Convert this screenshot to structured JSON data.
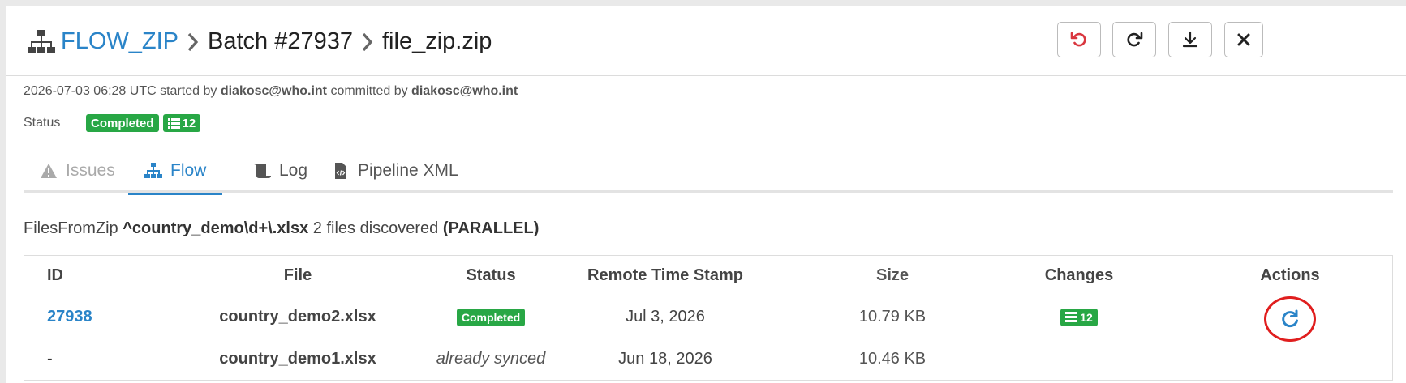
{
  "breadcrumb": {
    "root": "FLOW_ZIP",
    "batch": "Batch #27937",
    "file": "file_zip.zip"
  },
  "header_buttons": [
    {
      "name": "undo",
      "icon": "undo-icon",
      "color": "#d9363e"
    },
    {
      "name": "redo",
      "icon": "redo-icon",
      "color": "#222222"
    },
    {
      "name": "download",
      "icon": "download-icon",
      "color": "#222222"
    },
    {
      "name": "close",
      "icon": "close-icon",
      "color": "#222222"
    }
  ],
  "meta": {
    "timestamp": "2026-07-03 06:28 UTC",
    "started_by_label": "started by",
    "started_by": "diakosc@who.int",
    "committed_by_label": "committed by",
    "committed_by": "diakosc@who.int"
  },
  "status": {
    "label": "Status",
    "value": "Completed",
    "changes_count": "12"
  },
  "tabs": [
    {
      "label": "Issues",
      "icon": "warning-icon",
      "state": "disabled"
    },
    {
      "label": "Flow",
      "icon": "sitemap-icon",
      "state": "active"
    },
    {
      "label": "Log",
      "icon": "scroll-icon",
      "state": "normal"
    },
    {
      "label": "Pipeline XML",
      "icon": "code-file-icon",
      "state": "normal"
    }
  ],
  "files_line": {
    "prefix": "FilesFromZip",
    "pattern": "^country_demo\\d+\\.xlsx",
    "count_text": "2 files discovered",
    "mode": "(PARALLEL)"
  },
  "table": {
    "headers": [
      "ID",
      "File",
      "Status",
      "Remote Time Stamp",
      "Size",
      "Changes",
      "Actions"
    ],
    "rows": [
      {
        "id": "27938",
        "file": "country_demo2.xlsx",
        "status": "Completed",
        "timestamp": "Jul 3, 2026",
        "size": "10.79 KB",
        "changes": "12",
        "action_icon": "refresh-icon"
      },
      {
        "id": "-",
        "file": "country_demo1.xlsx",
        "status": "already synced",
        "timestamp": "Jun 18, 2026",
        "size": "10.46 KB",
        "changes": "",
        "action_icon": ""
      }
    ]
  },
  "colors": {
    "accent": "#2a84c8",
    "success": "#28a745",
    "highlight": "#e01e1e"
  }
}
